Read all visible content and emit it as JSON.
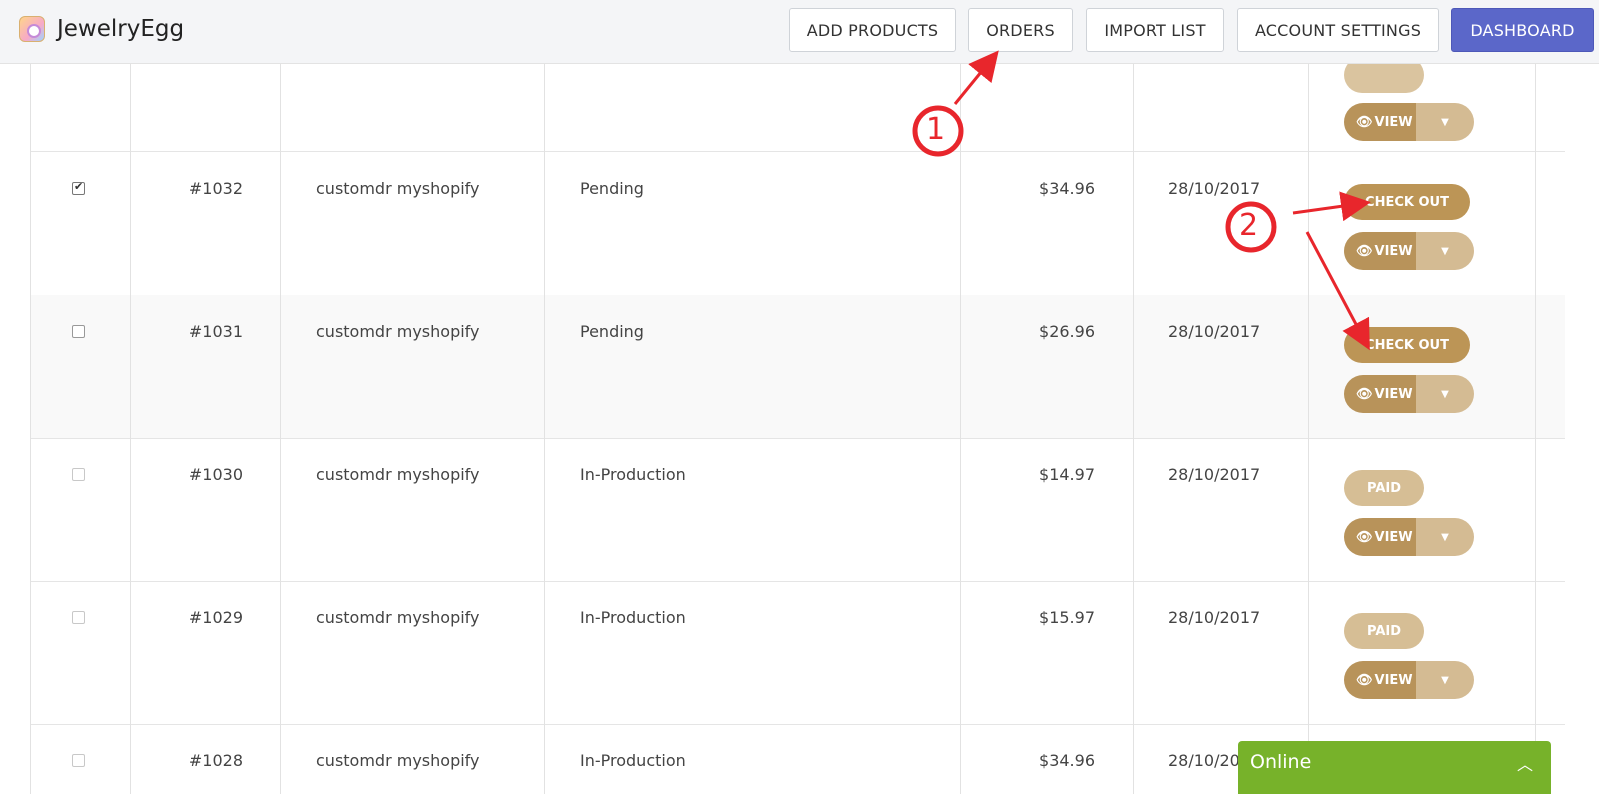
{
  "app": {
    "name": "JewelryEgg"
  },
  "nav": {
    "add_products": "ADD PRODUCTS",
    "orders": "ORDERS",
    "import_list": "IMPORT LIST",
    "account_settings": "ACCOUNT SETTINGS",
    "dashboard": "DASHBOARD"
  },
  "actions": {
    "checkout": "CHECK OUT",
    "paid": "PAID",
    "view": "VIEW"
  },
  "orders": [
    {
      "checked": true,
      "id": "#1032",
      "customer": "customdr myshopify",
      "status": "Pending",
      "total": "$34.96",
      "date": "28/10/2017",
      "action": "checkout"
    },
    {
      "checked": false,
      "id": "#1031",
      "customer": "customdr myshopify",
      "status": "Pending",
      "total": "$26.96",
      "date": "28/10/2017",
      "action": "checkout"
    },
    {
      "checked": false,
      "id": "#1030",
      "customer": "customdr myshopify",
      "status": "In-Production",
      "total": "$14.97",
      "date": "28/10/2017",
      "action": "paid"
    },
    {
      "checked": false,
      "id": "#1029",
      "customer": "customdr myshopify",
      "status": "In-Production",
      "total": "$15.97",
      "date": "28/10/2017",
      "action": "paid"
    },
    {
      "checked": false,
      "id": "#1028",
      "customer": "customdr myshopify",
      "status": "In-Production",
      "total": "$34.96",
      "date": "28/10/2017",
      "action": "none"
    }
  ],
  "annotations": {
    "step1": "1",
    "step2": "2"
  },
  "chat": {
    "label": "Online",
    "chevron": "chevron-up-icon"
  },
  "colors": {
    "gold": "#bc9556",
    "light_gold": "#d6be95",
    "primary": "#5b67c9",
    "online": "#77b22a",
    "annotation": "#e8262c"
  }
}
